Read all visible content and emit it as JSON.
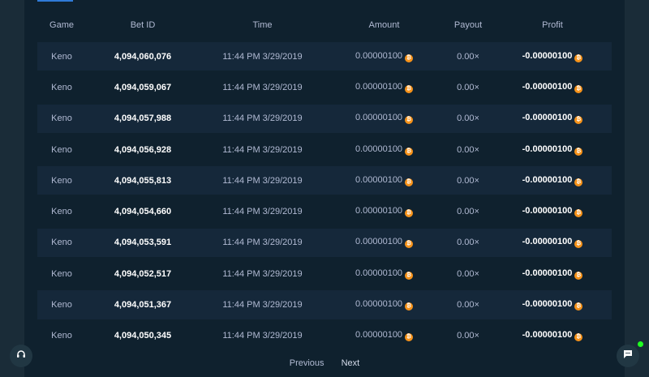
{
  "table": {
    "columns": [
      "Game",
      "Bet ID",
      "Time",
      "Amount",
      "Payout",
      "Profit"
    ],
    "coin_glyph": "₿",
    "rows": [
      {
        "game": "Keno",
        "bet_id": "4,094,060,076",
        "time": "11:44 PM 3/29/2019",
        "amount": "0.00000100",
        "payout": "0.00×",
        "profit": "-0.00000100"
      },
      {
        "game": "Keno",
        "bet_id": "4,094,059,067",
        "time": "11:44 PM 3/29/2019",
        "amount": "0.00000100",
        "payout": "0.00×",
        "profit": "-0.00000100"
      },
      {
        "game": "Keno",
        "bet_id": "4,094,057,988",
        "time": "11:44 PM 3/29/2019",
        "amount": "0.00000100",
        "payout": "0.00×",
        "profit": "-0.00000100"
      },
      {
        "game": "Keno",
        "bet_id": "4,094,056,928",
        "time": "11:44 PM 3/29/2019",
        "amount": "0.00000100",
        "payout": "0.00×",
        "profit": "-0.00000100"
      },
      {
        "game": "Keno",
        "bet_id": "4,094,055,813",
        "time": "11:44 PM 3/29/2019",
        "amount": "0.00000100",
        "payout": "0.00×",
        "profit": "-0.00000100"
      },
      {
        "game": "Keno",
        "bet_id": "4,094,054,660",
        "time": "11:44 PM 3/29/2019",
        "amount": "0.00000100",
        "payout": "0.00×",
        "profit": "-0.00000100"
      },
      {
        "game": "Keno",
        "bet_id": "4,094,053,591",
        "time": "11:44 PM 3/29/2019",
        "amount": "0.00000100",
        "payout": "0.00×",
        "profit": "-0.00000100"
      },
      {
        "game": "Keno",
        "bet_id": "4,094,052,517",
        "time": "11:44 PM 3/29/2019",
        "amount": "0.00000100",
        "payout": "0.00×",
        "profit": "-0.00000100"
      },
      {
        "game": "Keno",
        "bet_id": "4,094,051,367",
        "time": "11:44 PM 3/29/2019",
        "amount": "0.00000100",
        "payout": "0.00×",
        "profit": "-0.00000100"
      },
      {
        "game": "Keno",
        "bet_id": "4,094,050,345",
        "time": "11:44 PM 3/29/2019",
        "amount": "0.00000100",
        "payout": "0.00×",
        "profit": "-0.00000100"
      }
    ]
  },
  "pagination": {
    "previous_label": "Previous",
    "next_label": "Next"
  },
  "icons": {
    "coin": "bitcoin-icon",
    "support": "headset-icon",
    "chat": "chat-icon"
  },
  "colors": {
    "background": "#1a2c38",
    "panel": "#0f212e",
    "row_alt": "#15283a",
    "coin": "#f7931a",
    "online": "#1fff20"
  }
}
